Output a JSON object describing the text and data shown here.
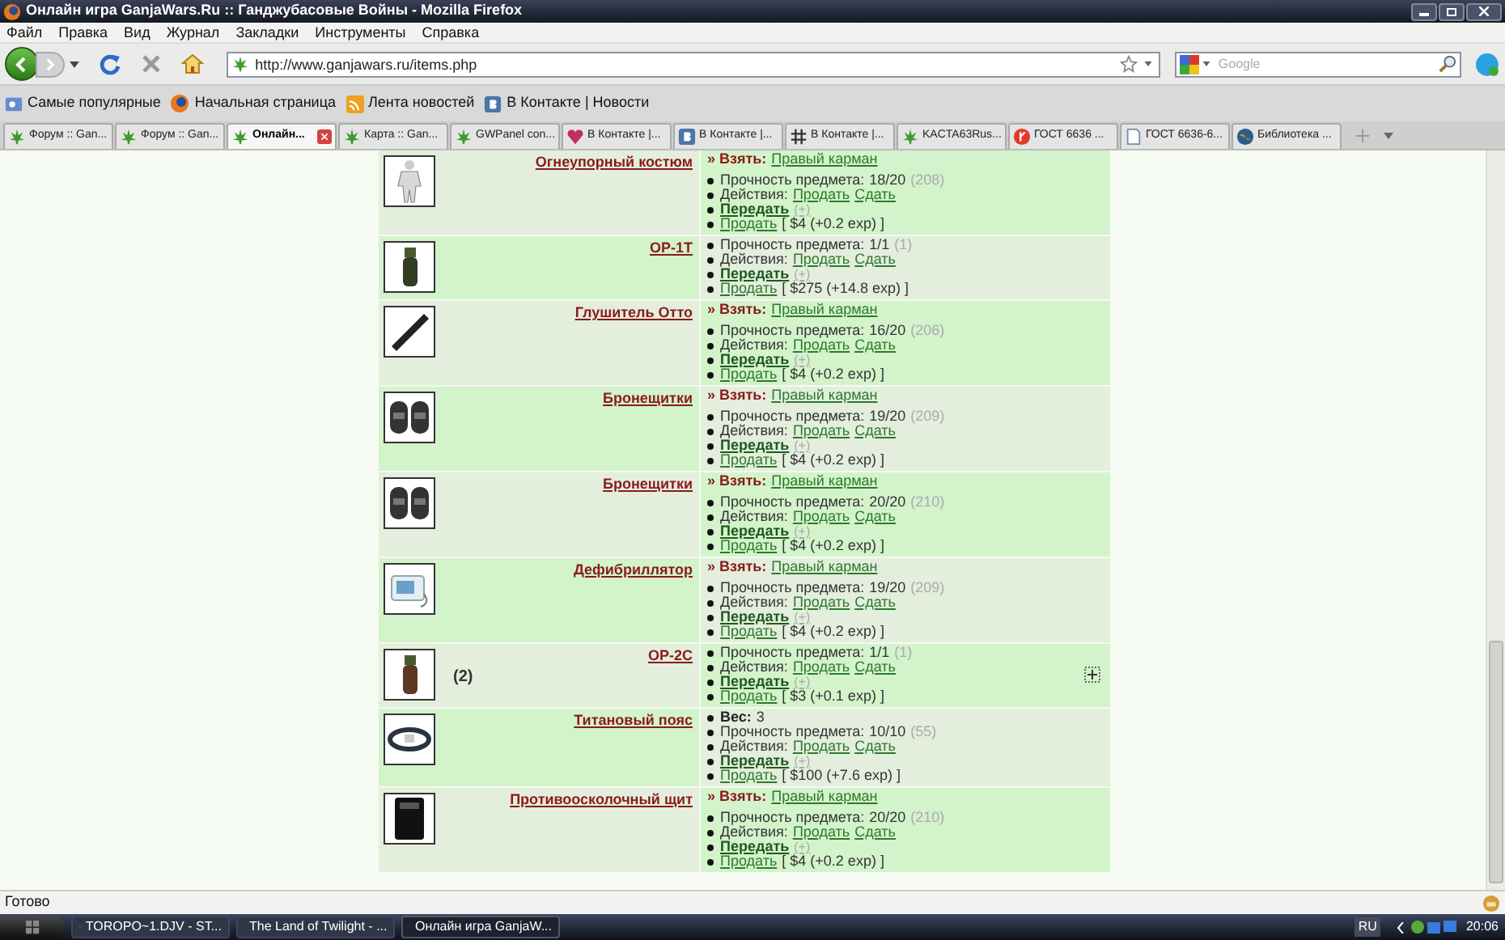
{
  "window": {
    "title": "Онлайн игра GanjaWars.Ru :: Ганджубасовые Войны - Mozilla Firefox"
  },
  "menu": [
    "Файл",
    "Правка",
    "Вид",
    "Журнал",
    "Закладки",
    "Инструменты",
    "Справка"
  ],
  "address": {
    "value": "http://www.ganjawars.ru/items.php"
  },
  "search": {
    "placeholder": "Google"
  },
  "bookmarks": [
    "Самые популярные",
    "Начальная страница",
    "Лента новостей",
    "В Контакте | Новости"
  ],
  "tabs": [
    {
      "label": "Форум :: Gan...",
      "selected": false
    },
    {
      "label": "Форум :: Gan...",
      "selected": false
    },
    {
      "label": "Онлайн...",
      "selected": true
    },
    {
      "label": "Карта :: Gan...",
      "selected": false
    },
    {
      "label": "GWPanel con...",
      "selected": false
    },
    {
      "label": "В Контакте |...",
      "selected": false
    },
    {
      "label": "В Контакте |...",
      "selected": false
    },
    {
      "label": "В Контакте |...",
      "selected": false
    },
    {
      "label": "KACTA63Rus...",
      "selected": false
    },
    {
      "label": "ГОСТ 6636 ...",
      "selected": false
    },
    {
      "label": "ГОСТ 6636-6...",
      "selected": false
    },
    {
      "label": "Библиотека ...",
      "selected": false
    }
  ],
  "items": [
    {
      "name": "Огнеупорный костюм",
      "expandable": false,
      "take": {
        "label": "» Взять:",
        "link": "Правый карман"
      },
      "lines": [
        {
          "kind": "durability",
          "label": "Прочность предмета:",
          "value": "18/20",
          "extra": "(208)"
        },
        {
          "kind": "actions",
          "label": "Действия:",
          "links": [
            "Продать",
            "Сдать"
          ]
        },
        {
          "kind": "transfer",
          "link": "Передать",
          "plus": "(+)"
        },
        {
          "kind": "sell",
          "link": "Продать",
          "price": "[ $4 (+0.2 exp) ]"
        }
      ]
    },
    {
      "name": "ОР-1Т",
      "expandable": false,
      "lines": [
        {
          "kind": "durability",
          "label": "Прочность предмета:",
          "value": "1/1",
          "extra": "(1)"
        },
        {
          "kind": "actions",
          "label": "Действия:",
          "links": [
            "Продать",
            "Сдать"
          ]
        },
        {
          "kind": "transfer",
          "link": "Передать",
          "plus": "(+)"
        },
        {
          "kind": "sell",
          "link": "Продать",
          "price": "[ $275 (+14.8 exp) ]"
        }
      ]
    },
    {
      "name": "Глушитель Отто",
      "expandable": false,
      "take": {
        "label": "» Взять:",
        "link": "Правый карман"
      },
      "lines": [
        {
          "kind": "durability",
          "label": "Прочность предмета:",
          "value": "16/20",
          "extra": "(206)"
        },
        {
          "kind": "actions",
          "label": "Действия:",
          "links": [
            "Продать",
            "Сдать"
          ]
        },
        {
          "kind": "transfer",
          "link": "Передать",
          "plus": "(+)"
        },
        {
          "kind": "sell",
          "link": "Продать",
          "price": "[ $4 (+0.2 exp) ]"
        }
      ]
    },
    {
      "name": "Бронещитки",
      "expandable": false,
      "take": {
        "label": "» Взять:",
        "link": "Правый карман"
      },
      "lines": [
        {
          "kind": "durability",
          "label": "Прочность предмета:",
          "value": "19/20",
          "extra": "(209)"
        },
        {
          "kind": "actions",
          "label": "Действия:",
          "links": [
            "Продать",
            "Сдать"
          ]
        },
        {
          "kind": "transfer",
          "link": "Передать",
          "plus": "(+)"
        },
        {
          "kind": "sell",
          "link": "Продать",
          "price": "[ $4 (+0.2 exp) ]"
        }
      ]
    },
    {
      "name": "Бронещитки",
      "expandable": false,
      "take": {
        "label": "» Взять:",
        "link": "Правый карман"
      },
      "lines": [
        {
          "kind": "durability",
          "label": "Прочность предмета:",
          "value": "20/20",
          "extra": "(210)"
        },
        {
          "kind": "actions",
          "label": "Действия:",
          "links": [
            "Продать",
            "Сдать"
          ]
        },
        {
          "kind": "transfer",
          "link": "Передать",
          "plus": "(+)"
        },
        {
          "kind": "sell",
          "link": "Продать",
          "price": "[ $4 (+0.2 exp) ]"
        }
      ]
    },
    {
      "name": "Дефибриллятор",
      "expandable": false,
      "take": {
        "label": "» Взять:",
        "link": "Правый карман"
      },
      "lines": [
        {
          "kind": "durability",
          "label": "Прочность предмета:",
          "value": "19/20",
          "extra": "(209)"
        },
        {
          "kind": "actions",
          "label": "Действия:",
          "links": [
            "Продать",
            "Сдать"
          ]
        },
        {
          "kind": "transfer",
          "link": "Передать",
          "plus": "(+)"
        },
        {
          "kind": "sell",
          "link": "Продать",
          "price": "[ $4 (+0.2 exp) ]"
        }
      ]
    },
    {
      "name": "ОР-2С",
      "count": "(2)",
      "expandable": true,
      "lines": [
        {
          "kind": "durability",
          "label": "Прочность предмета:",
          "value": "1/1",
          "extra": "(1)"
        },
        {
          "kind": "actions",
          "label": "Действия:",
          "links": [
            "Продать",
            "Сдать"
          ]
        },
        {
          "kind": "transfer",
          "link": "Передать",
          "plus": "(+)"
        },
        {
          "kind": "sell",
          "link": "Продать",
          "price": "[ $3 (+0.1 exp) ]"
        }
      ]
    },
    {
      "name": "Титановый пояс",
      "expandable": false,
      "lines": [
        {
          "kind": "weight",
          "label": "Вес:",
          "value": "3"
        },
        {
          "kind": "durability",
          "label": "Прочность предмета:",
          "value": "10/10",
          "extra": "(55)"
        },
        {
          "kind": "actions",
          "label": "Действия:",
          "links": [
            "Продать",
            "Сдать"
          ]
        },
        {
          "kind": "transfer",
          "link": "Передать",
          "plus": "(+)"
        },
        {
          "kind": "sell",
          "link": "Продать",
          "price": "[ $100 (+7.6 exp) ]"
        }
      ]
    },
    {
      "name": "Противоосколочный щит",
      "expandable": false,
      "take": {
        "label": "» Взять:",
        "link": "Правый карман"
      },
      "lines": [
        {
          "kind": "durability",
          "label": "Прочность предмета:",
          "value": "20/20",
          "extra": "(210)"
        },
        {
          "kind": "actions",
          "label": "Действия:",
          "links": [
            "Продать",
            "Сдать"
          ]
        },
        {
          "kind": "transfer",
          "link": "Передать",
          "plus": "(+)"
        },
        {
          "kind": "sell",
          "link": "Продать",
          "price": "[ $4 (+0.2 exp) ]"
        }
      ]
    }
  ],
  "status_bar": "Готово",
  "taskbar": {
    "windows": [
      {
        "label": "TOROPO~1.DJV - ST...",
        "selected": false
      },
      {
        "label": "The Land of Twilight - ...",
        "selected": false
      },
      {
        "label": "Онлайн игра GanjaW...",
        "selected": true
      }
    ],
    "language": "RU",
    "clock": "20:06"
  }
}
